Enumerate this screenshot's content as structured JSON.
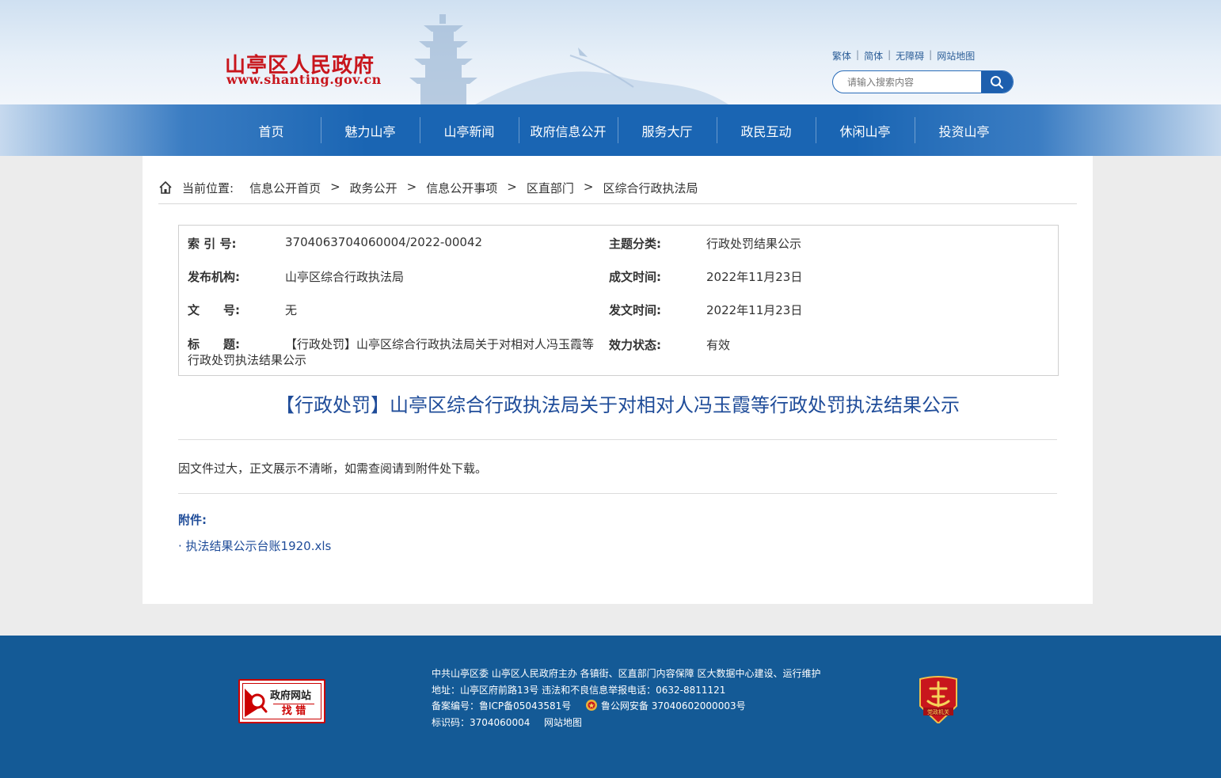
{
  "header": {
    "site_title": "山亭区人民政府",
    "site_url": "www.shanting.gov.cn",
    "top_links": [
      "繁体",
      "简体",
      "无障碍",
      "网站地图"
    ],
    "search_placeholder": "请输入搜索内容"
  },
  "nav": {
    "items": [
      "首页",
      "魅力山亭",
      "山亭新闻",
      "政府信息公开",
      "服务大厅",
      "政民互动",
      "休闲山亭",
      "投资山亭"
    ]
  },
  "breadcrumb": {
    "label": "当前位置:",
    "items": [
      "信息公开首页",
      "政务公开",
      "信息公开事项",
      "区直部门",
      "区综合行政执法局"
    ],
    "separator": ">"
  },
  "meta": {
    "index_label": "索 引 号:",
    "index_value": "3704063704060004/2022-00042",
    "topic_label": "主题分类:",
    "topic_value": "行政处罚结果公示",
    "publisher_label": "发布机构:",
    "publisher_value": "山亭区综合行政执法局",
    "created_label": "成文时间:",
    "created_value": "2022年11月23日",
    "docno_label": "文　　号:",
    "docno_value": "无",
    "issued_label": "发文时间:",
    "issued_value": "2022年11月23日",
    "title_label": "标　　题:",
    "title_value": "【行政处罚】山亭区综合行政执法局关于对相对人冯玉霞等行政处罚执法结果公示",
    "status_label": "效力状态:",
    "status_value": "有效"
  },
  "article": {
    "title": "【行政处罚】山亭区综合行政执法局关于对相对人冯玉霞等行政处罚执法结果公示",
    "body": "因文件过大，正文展示不清晰，如需查阅请到附件处下载。",
    "attachments_label": "附件:",
    "attachment_link": "· 执法结果公示台账1920.xls"
  },
  "footer": {
    "error_badge_top": "政府网站",
    "error_badge_bottom": "找 错",
    "line1": "中共山亭区委 山亭区人民政府主办 各镇街、区直部门内容保障 区大数据中心建设、运行维护",
    "line2": "地址：山亭区府前路13号 违法和不良信息举报电话：0632-8811121",
    "icp": "备案编号：鲁ICP备05043581号",
    "police": "鲁公网安备 37040602000003号",
    "id_code": "标识码：3704060004",
    "sitemap": "网站地图",
    "party_badge_text": "党政机关"
  },
  "colors": {
    "brand_red": "#c8161d",
    "nav_blue": "#1a65b3",
    "title_blue": "#1f4c99",
    "footer_blue": "#145a96"
  }
}
